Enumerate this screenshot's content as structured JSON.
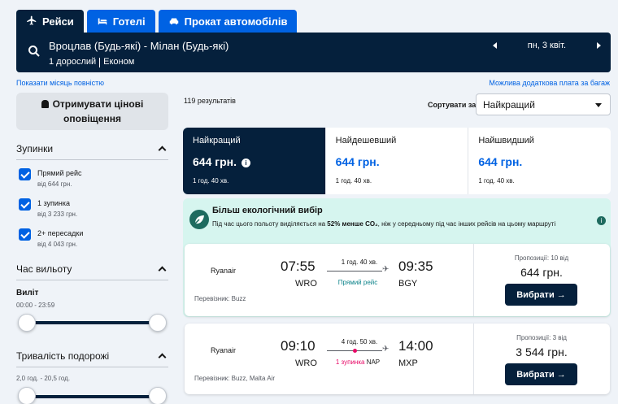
{
  "tabs": [
    {
      "label": "Рейси",
      "icon": "plane-icon"
    },
    {
      "label": "Готелі",
      "icon": "bed-icon"
    },
    {
      "label": "Прокат автомобілів",
      "icon": "car-icon"
    }
  ],
  "search": {
    "route": "Вроцлав (Будь-які) - Мілан (Будь-які)",
    "passengers": "1 дорослий",
    "cabin": "Економ",
    "date": "пн, 3 квіт."
  },
  "links": {
    "show_month": "Показати місяць повністю",
    "baggage_fee": "Можлива додаткова плата за багаж"
  },
  "sidebar": {
    "alert_label": "Отримувати цінові оповіщення",
    "stops_title": "Зупинки",
    "stops": [
      {
        "label": "Прямий рейс",
        "price": "від 644 грн."
      },
      {
        "label": "1 зупинка",
        "price": "від 3 233 грн."
      },
      {
        "label": "2+ пересадки",
        "price": "від 4 043 грн."
      }
    ],
    "departure_title": "Час вильоту",
    "outbound_label": "Виліт",
    "outbound_range": "00:00 - 23:59",
    "duration_title": "Тривалість подорожі",
    "duration_range": "2,0 год. - 20,5 год."
  },
  "results": {
    "count": "119 результатів",
    "sort_label": "Сортувати за",
    "sort_value": "Найкращий"
  },
  "sort_tabs": [
    {
      "name": "Найкращий",
      "price": "644 грн.",
      "duration": "1 год. 40 хв."
    },
    {
      "name": "Найдешевший",
      "price": "644 грн.",
      "duration": "1 год. 40 хв."
    },
    {
      "name": "Найшвидший",
      "price": "644 грн.",
      "duration": "1 год. 40 хв."
    }
  ],
  "eco": {
    "title": "Більш екологічний вибір",
    "text_before": "Під час цього польоту виділяється на ",
    "text_bold": "52% менше CO₂",
    "text_after": ", ніж у середньому під час інших рейсів на цьому маршруті"
  },
  "flights": [
    {
      "airline": "Ryanair",
      "carrier": "Перевізник: Buzz",
      "dep_time": "07:55",
      "dep_code": "WRO",
      "arr_time": "09:35",
      "arr_code": "BGY",
      "duration": "1 год. 40 хв.",
      "stops": "Прямий рейс",
      "offers": "Пропозиції: 10 від",
      "price": "644 грн.",
      "button": "Вибрати →"
    },
    {
      "airline": "Ryanair",
      "carrier": "Перевізник: Buzz, Malta Air",
      "dep_time": "09:10",
      "dep_code": "WRO",
      "arr_time": "14:00",
      "arr_code": "MXP",
      "duration": "4 год. 50 хв.",
      "stops": "1 зупинка",
      "stop_code": "NAP",
      "offers": "Пропозиції: 3 від",
      "price": "3 544 грн.",
      "button": "Вибрати →"
    }
  ],
  "colors": {
    "navy": "#05203c",
    "blue": "#0062e3",
    "green": "#0c838a",
    "pink": "#e70866",
    "eco_bg": "#d6f5ef"
  }
}
